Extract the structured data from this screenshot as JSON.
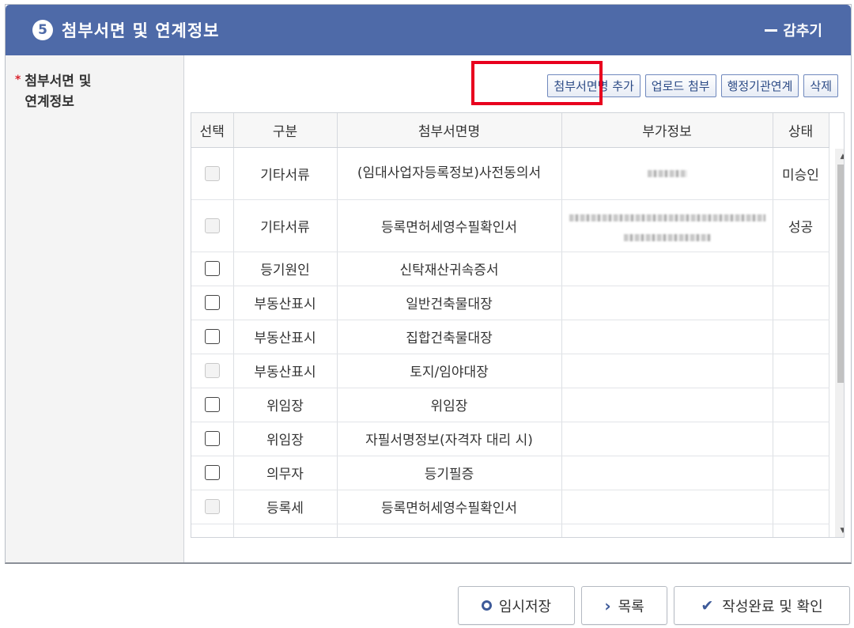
{
  "section": {
    "step_number": "5",
    "title": "첨부서면 및 연계정보",
    "collapse_label": "감추기"
  },
  "field_label": {
    "required_mark": "*",
    "line1": "첨부서면 및",
    "line2": "연계정보"
  },
  "toolbar": {
    "add_doc_name": "첨부서면명 추가",
    "upload_attach": "업로드 첨부",
    "agency_link": "행정기관연계",
    "delete": "삭제"
  },
  "table": {
    "headers": [
      "선택",
      "구분",
      "첨부서면명",
      "부가정보",
      "상태"
    ],
    "rows": [
      {
        "checkbox_enabled": false,
        "category": "기타서류",
        "doc_name": "(임대사업자등록정보)사전동의서",
        "extra_info": "[redacted]",
        "status": "미승인"
      },
      {
        "checkbox_enabled": false,
        "category": "기타서류",
        "doc_name": "등록면허세영수필확인서",
        "extra_info": "[redacted]",
        "status": "성공"
      },
      {
        "checkbox_enabled": true,
        "category": "등기원인",
        "doc_name": "신탁재산귀속증서",
        "extra_info": "",
        "status": ""
      },
      {
        "checkbox_enabled": true,
        "category": "부동산표시",
        "doc_name": "일반건축물대장",
        "extra_info": "",
        "status": ""
      },
      {
        "checkbox_enabled": true,
        "category": "부동산표시",
        "doc_name": "집합건축물대장",
        "extra_info": "",
        "status": ""
      },
      {
        "checkbox_enabled": false,
        "category": "부동산표시",
        "doc_name": "토지/임야대장",
        "extra_info": "",
        "status": ""
      },
      {
        "checkbox_enabled": true,
        "category": "위임장",
        "doc_name": "위임장",
        "extra_info": "",
        "status": ""
      },
      {
        "checkbox_enabled": true,
        "category": "위임장",
        "doc_name": "자필서명정보(자격자 대리 시)",
        "extra_info": "",
        "status": ""
      },
      {
        "checkbox_enabled": true,
        "category": "의무자",
        "doc_name": "등기필증",
        "extra_info": "",
        "status": ""
      },
      {
        "checkbox_enabled": false,
        "category": "등록세",
        "doc_name": "등록면허세영수필확인서",
        "extra_info": "",
        "status": ""
      }
    ]
  },
  "footer": {
    "temp_save": "임시저장",
    "list": "목록",
    "complete_confirm": "작성완료 및 확인"
  },
  "colors": {
    "header_bg": "#4e6aa8",
    "highlight_border": "#e8001e",
    "required_star": "#d9232d",
    "button_text": "#2c4b86"
  }
}
